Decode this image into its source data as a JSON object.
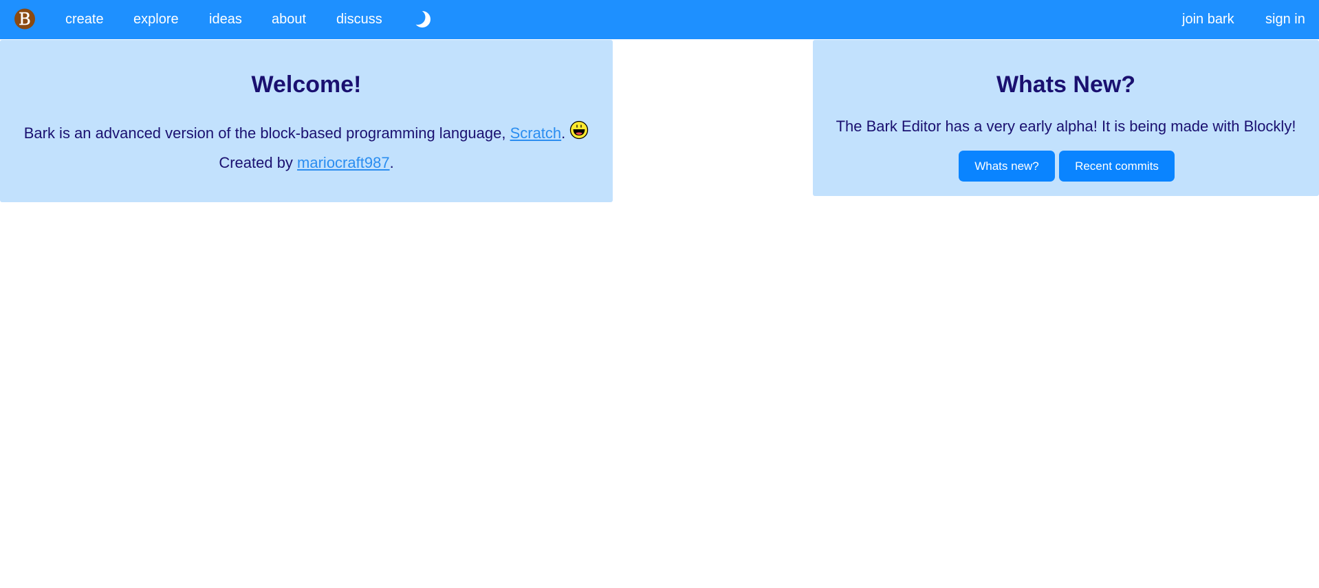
{
  "nav": {
    "logo_letter": "B",
    "links": {
      "create": "create",
      "explore": "explore",
      "ideas": "ideas",
      "about": "about",
      "discuss": "discuss"
    },
    "theme_toggle_icon": "moon-icon",
    "right_links": {
      "join": "join bark",
      "sign_in": "sign in"
    }
  },
  "welcome": {
    "title": "Welcome!",
    "description_prefix": "Bark is an advanced version of the block-based programming language, ",
    "scratch_link": "Scratch",
    "description_suffix": ".",
    "emoji_icon": "smiley-icon",
    "created_by_prefix": "Created by ",
    "author_link": "mariocraft987",
    "created_by_suffix": "."
  },
  "news": {
    "title": "Whats New?",
    "description": "The Bark Editor has a very early alpha! It is being made with Blockly!",
    "buttons": {
      "whats_new": "Whats new?",
      "recent_commits": "Recent commits"
    }
  },
  "colors": {
    "navbar": "#1e90ff",
    "card_background": "#c2e1fd",
    "heading_text": "#1a1070",
    "link": "#2a8df0",
    "button": "#0a84ff",
    "logo_fill": "#8b4a12"
  }
}
